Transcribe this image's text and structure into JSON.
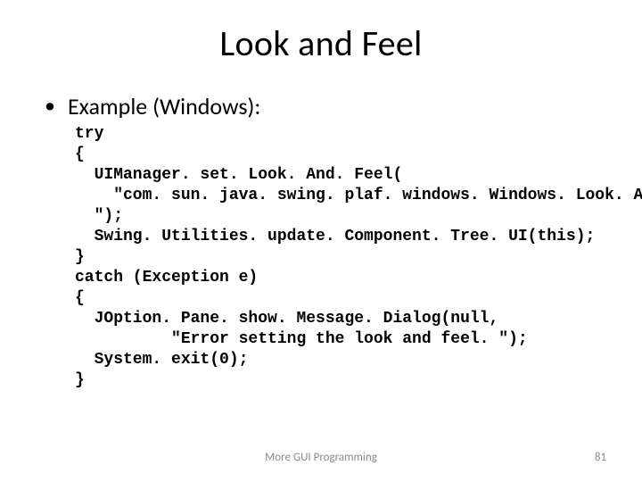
{
  "title": "Look and Feel",
  "bullet": "Example (Windows):",
  "code": "try\n{\n  UIManager. set. Look. And. Feel(\n    \"com. sun. java. swing. plaf. windows. Windows. Look. And. Feel\n  \");\n  Swing. Utilities. update. Component. Tree. UI(this);\n}\ncatch (Exception e)\n{\n  JOption. Pane. show. Message. Dialog(null,\n          \"Error setting the look and feel. \");\n  System. exit(0);\n}",
  "footer": "More GUI Programming",
  "page": "81"
}
